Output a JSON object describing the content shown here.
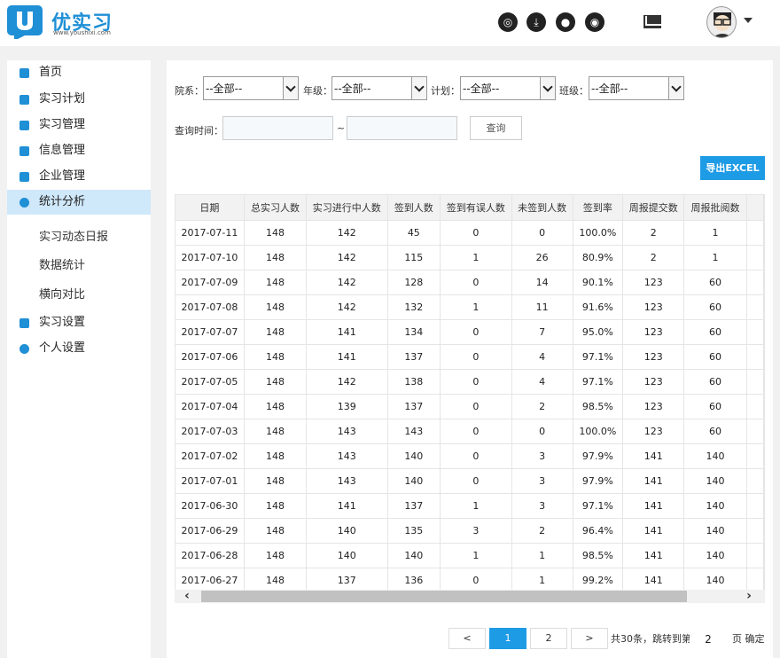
{
  "header": {
    "logo_text": "优实习",
    "logo_sub": "www.youshixi.com",
    "icons": [
      "aperture-icon",
      "download-icon",
      "wechat-icon",
      "weibo-icon",
      "mail-icon"
    ]
  },
  "sidebar": {
    "items": [
      {
        "label": "首页",
        "icon": "home-icon"
      },
      {
        "label": "实习计划",
        "icon": "clipboard-icon"
      },
      {
        "label": "实习管理",
        "icon": "monitor-icon"
      },
      {
        "label": "信息管理",
        "icon": "info-icon"
      },
      {
        "label": "企业管理",
        "icon": "factory-icon"
      },
      {
        "label": "统计分析",
        "icon": "pie-chart-icon"
      },
      {
        "label": "实习设置",
        "icon": "book-icon"
      },
      {
        "label": "个人设置",
        "icon": "gear-icon"
      }
    ],
    "sub_items": [
      "实习动态日报",
      "数据统计",
      "横向对比"
    ]
  },
  "filters": {
    "dept_label": "院系：",
    "dept_value": "--全部--",
    "grade_label": "年级：",
    "grade_value": "--全部--",
    "plan_label": "计划：",
    "plan_value": "--全部--",
    "class_label": "班级：",
    "class_value": "--全部--",
    "time_label": "查询时间：",
    "tilde": "~",
    "query_label": "查询",
    "export_label": "导出EXCEL"
  },
  "table": {
    "headers": [
      "日期",
      "总实习人数",
      "实习进行中人数",
      "签到人数",
      "签到有误人数",
      "未签到人数",
      "签到率",
      "周报提交数",
      "周报批阅数"
    ],
    "rows": [
      [
        "2017-07-11",
        "148",
        "142",
        "45",
        "0",
        "0",
        "100.0%",
        "2",
        "1"
      ],
      [
        "2017-07-10",
        "148",
        "142",
        "115",
        "1",
        "26",
        "80.9%",
        "2",
        "1"
      ],
      [
        "2017-07-09",
        "148",
        "142",
        "128",
        "0",
        "14",
        "90.1%",
        "123",
        "60"
      ],
      [
        "2017-07-08",
        "148",
        "142",
        "132",
        "1",
        "11",
        "91.6%",
        "123",
        "60"
      ],
      [
        "2017-07-07",
        "148",
        "141",
        "134",
        "0",
        "7",
        "95.0%",
        "123",
        "60"
      ],
      [
        "2017-07-06",
        "148",
        "141",
        "137",
        "0",
        "4",
        "97.1%",
        "123",
        "60"
      ],
      [
        "2017-07-05",
        "148",
        "142",
        "138",
        "0",
        "4",
        "97.1%",
        "123",
        "60"
      ],
      [
        "2017-07-04",
        "148",
        "139",
        "137",
        "0",
        "2",
        "98.5%",
        "123",
        "60"
      ],
      [
        "2017-07-03",
        "148",
        "143",
        "143",
        "0",
        "0",
        "100.0%",
        "123",
        "60"
      ],
      [
        "2017-07-02",
        "148",
        "143",
        "140",
        "0",
        "3",
        "97.9%",
        "141",
        "140"
      ],
      [
        "2017-07-01",
        "148",
        "143",
        "140",
        "0",
        "3",
        "97.9%",
        "141",
        "140"
      ],
      [
        "2017-06-30",
        "148",
        "141",
        "137",
        "1",
        "3",
        "97.1%",
        "141",
        "140"
      ],
      [
        "2017-06-29",
        "148",
        "140",
        "135",
        "3",
        "2",
        "96.4%",
        "141",
        "140"
      ],
      [
        "2017-06-28",
        "148",
        "140",
        "140",
        "1",
        "1",
        "98.5%",
        "141",
        "140"
      ],
      [
        "2017-06-27",
        "148",
        "137",
        "136",
        "0",
        "1",
        "99.2%",
        "141",
        "140"
      ]
    ]
  },
  "pagination": {
    "prev": "<",
    "page1": "1",
    "page2": "2",
    "next": ">",
    "info": "共30条，跳转到第",
    "page_input": "2",
    "suffix": "页 确定"
  }
}
